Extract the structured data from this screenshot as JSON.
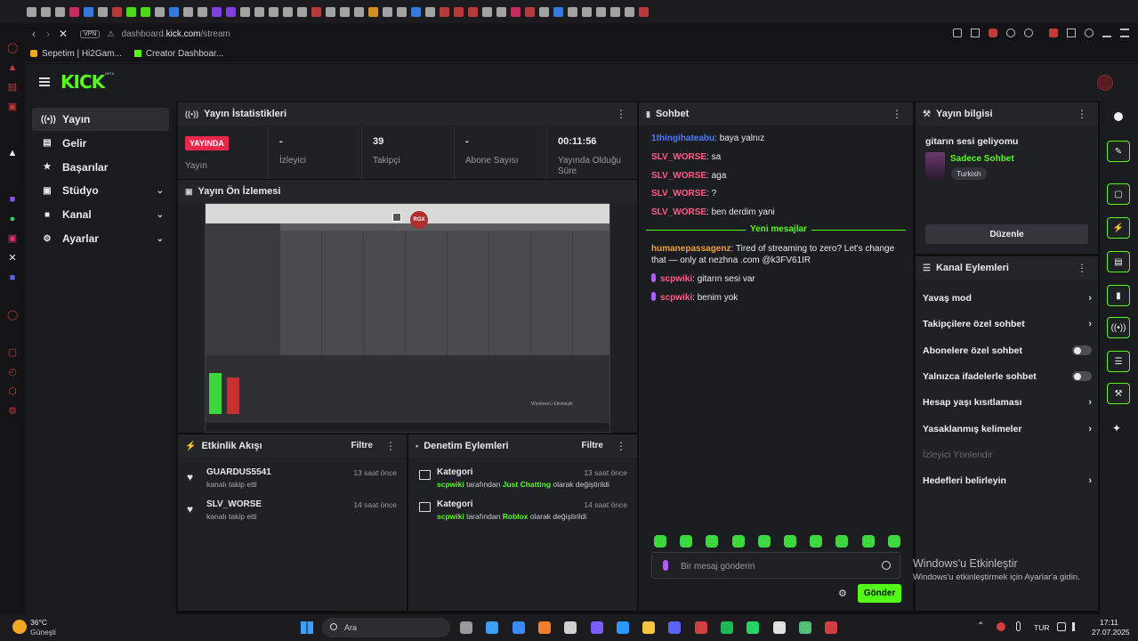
{
  "browser": {
    "url_prefix": "dashboard.",
    "url_domain": "kick.com",
    "url_path": "/stream",
    "vpn_badge": "VPN",
    "bookmarks": [
      "Sepetim | Hi2Gam...",
      "Creator Dashboar..."
    ]
  },
  "brand": {
    "logo": "KICK",
    "logo_badge": "BETA",
    "accent": "#53fc18"
  },
  "nav": {
    "items": [
      {
        "label": "Yayın",
        "icon": "broadcast-icon",
        "active": true
      },
      {
        "label": "Gelir",
        "icon": "revenue-icon"
      },
      {
        "label": "Başarılar",
        "icon": "trophy-icon"
      },
      {
        "label": "Stüdyo",
        "icon": "studio-icon",
        "expandable": true
      },
      {
        "label": "Kanal",
        "icon": "channel-icon",
        "expandable": true
      },
      {
        "label": "Ayarlar",
        "icon": "gear-icon",
        "expandable": true
      }
    ]
  },
  "stats": {
    "title": "Yayın İstatistikleri",
    "live_badge": "YAYINDA",
    "live_label": "Yayın",
    "cells": [
      {
        "value": "-",
        "label": "İzleyici"
      },
      {
        "value": "39",
        "label": "Takipçi"
      },
      {
        "value": "-",
        "label": "Abone Sayısı"
      },
      {
        "value": "00:11:56",
        "label": "Yayında Olduğu Süre"
      }
    ]
  },
  "preview": {
    "title": "Yayın Ön İzlemesi",
    "overlay_text": "RGX",
    "watermark": "Windows'u Etkinleştir"
  },
  "activity": {
    "title": "Etkinlik Akışı",
    "filter": "Filtre",
    "items": [
      {
        "user": "GUARDUS5541",
        "desc": "kanalı takip etti",
        "time": "13 saat önce"
      },
      {
        "user": "SLV_WORSE",
        "desc": "kanalı takip etti",
        "time": "14 saat önce"
      }
    ]
  },
  "moderation": {
    "title": "Denetim Eylemleri",
    "filter": "Filtre",
    "items": [
      {
        "title": "Kategori",
        "user": "scpwiki",
        "mid": " tarafından ",
        "value": "Just Chatting",
        "end": " olarak değiştirildi",
        "time": "13 saat önce"
      },
      {
        "title": "Kategori",
        "user": "scpwiki",
        "mid": " tarafından ",
        "value": "Roblox",
        "end": " olarak değiştirildi",
        "time": "14 saat önce"
      }
    ]
  },
  "chat": {
    "title": "Sohbet",
    "messages": [
      {
        "user": "1thingihateabu",
        "text": "baya yalnız",
        "color": "#4a7bff"
      },
      {
        "user": "SLV_WORSE",
        "text": "sa",
        "color": "#ff5c8a"
      },
      {
        "user": "SLV_WORSE",
        "text": "aga",
        "color": "#ff5c8a"
      },
      {
        "user": "SLV_WORSE",
        "text": "?",
        "color": "#ff5c8a"
      },
      {
        "user": "SLV_WORSE",
        "text": "ben derdim yani",
        "color": "#ff5c8a"
      }
    ],
    "new_messages_label": "Yeni mesajlar",
    "new_messages": [
      {
        "user": "humanepassagenz",
        "text": "Tired of streaming to zero? Let's change that — only at nezhna .com @k3FV61IR",
        "color": "#f0a030"
      },
      {
        "user": "scpwiki",
        "text": "gitarın sesi var",
        "color": "#ff5c8a",
        "badge": true
      },
      {
        "user": "scpwiki",
        "text": "benim yok",
        "color": "#ff5c8a",
        "badge": true
      }
    ],
    "input_placeholder": "Bir mesaj gönderin",
    "send_label": "Gönder"
  },
  "stream_info": {
    "title": "Yayın bilgisi",
    "stream_title": "gitarın sesi geliyomu",
    "category": "Sadece Sohbet",
    "language": "Turkish",
    "edit_label": "Düzenle"
  },
  "channel_actions": {
    "title": "Kanal Eylemleri",
    "items": [
      {
        "label": "Yavaş mod",
        "kind": "chevron"
      },
      {
        "label": "Takipçilere özel sohbet",
        "kind": "chevron"
      },
      {
        "label": "Abonelere özel sohbet",
        "kind": "toggle",
        "on": false
      },
      {
        "label": "Yalnızca ifadelerle sohbet",
        "kind": "toggle",
        "on": false
      },
      {
        "label": "Hesap yaşı kısıtlaması",
        "kind": "chevron"
      },
      {
        "label": "Yasaklanmış kelimeler",
        "kind": "chevron"
      },
      {
        "label": "İzleyici Yönlendir",
        "kind": "disabled"
      },
      {
        "label": "Hedefleri belirleyin",
        "kind": "chevron"
      }
    ]
  },
  "activation": {
    "title": "Windows'u Etkinleştir",
    "subtitle": "Windows'u etkinleştirmek için Ayarlar'a gidin."
  },
  "taskbar": {
    "weather_temp": "36°C",
    "weather_desc": "Güneşli",
    "search_label": "Ara",
    "language": "TUR",
    "time": "17:11",
    "date": "27.07.2025"
  }
}
